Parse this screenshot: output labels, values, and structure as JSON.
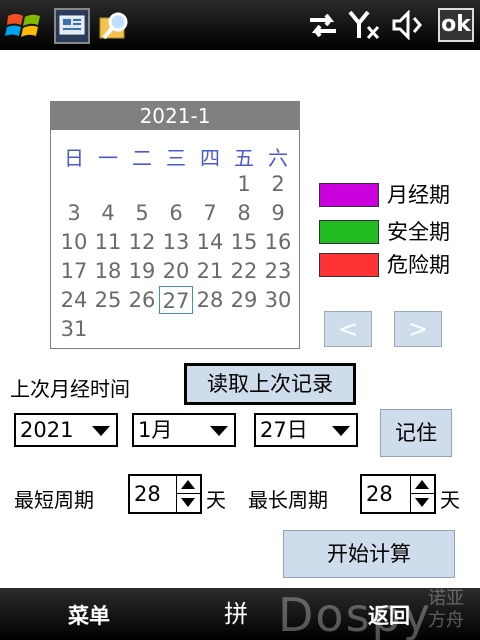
{
  "status_bar": {
    "ok_label": "ok",
    "icons": [
      "windows-start-icon",
      "app-icon",
      "search-folder-icon",
      "sync-arrows-icon",
      "signal-off-icon",
      "speaker-muted-icon"
    ]
  },
  "calendar": {
    "month_title": "2021-1",
    "weekdays": [
      "日",
      "一",
      "二",
      "三",
      "四",
      "五",
      "六"
    ],
    "weeks": [
      [
        "",
        "",
        "",
        "",
        "",
        "1",
        "2"
      ],
      [
        "3",
        "4",
        "5",
        "6",
        "7",
        "8",
        "9"
      ],
      [
        "10",
        "11",
        "12",
        "13",
        "14",
        "15",
        "16"
      ],
      [
        "17",
        "18",
        "19",
        "20",
        "21",
        "22",
        "23"
      ],
      [
        "24",
        "25",
        "26",
        "27",
        "28",
        "29",
        "30"
      ],
      [
        "31",
        "",
        "",
        "",
        "",
        "",
        ""
      ]
    ],
    "selected_day": "27",
    "prev_label": "<",
    "next_label": ">"
  },
  "legend": [
    {
      "label": "月经期",
      "color": "#cc00dd"
    },
    {
      "label": "安全期",
      "color": "#22bb22"
    },
    {
      "label": "危险期",
      "color": "#ff3333"
    }
  ],
  "form": {
    "last_period_label": "上次月经时间",
    "read_last_button": "读取上次记录",
    "year_value": "2021",
    "month_value": "1月",
    "day_value": "27日",
    "remember_button": "记住",
    "shortest_cycle_label": "最短周期",
    "shortest_cycle_value": "28",
    "shortest_unit": "天",
    "longest_cycle_label": "最长周期",
    "longest_cycle_value": "28",
    "longest_unit": "天",
    "start_button": "开始计算"
  },
  "soft_keys": {
    "left": "菜单",
    "middle": "拼",
    "right": "返回"
  },
  "watermark": {
    "brand": "Dospy",
    "brand_cn": "诺亚方舟"
  }
}
